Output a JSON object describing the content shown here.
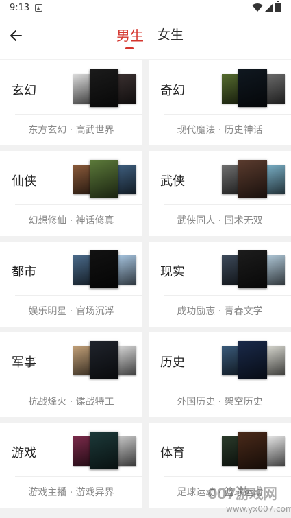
{
  "status_bar": {
    "time": "9:13"
  },
  "header": {
    "back_icon": "arrow-left-icon",
    "tabs": [
      {
        "label": "男生",
        "active": true
      },
      {
        "label": "女生",
        "active": false
      }
    ],
    "accent_color": "#d4352e"
  },
  "categories": [
    {
      "name": "玄幻",
      "tags": "东方玄幻 · 高武世界",
      "cover_colors": [
        "#dcdcdc",
        "#1b1b1b",
        "#3a3030"
      ]
    },
    {
      "name": "奇幻",
      "tags": "现代魔法 · 历史神话",
      "cover_colors": [
        "#556b2f",
        "#101820",
        "#6b6b6b"
      ]
    },
    {
      "name": "仙侠",
      "tags": "幻想修仙 · 神话修真",
      "cover_colors": [
        "#8a5a3a",
        "#5c7a3a",
        "#3f5f7f"
      ]
    },
    {
      "name": "武侠",
      "tags": "武侠同人 · 国术无双",
      "cover_colors": [
        "#6f6f6f",
        "#5a3b2e",
        "#7ab0c7"
      ]
    },
    {
      "name": "都市",
      "tags": "娱乐明星 · 官场沉浮",
      "cover_colors": [
        "#4a6a8a",
        "#121212",
        "#a7c5e0"
      ]
    },
    {
      "name": "现实",
      "tags": "成功励志 · 青春文学",
      "cover_colors": [
        "#3d4a5a",
        "#1c1c1c",
        "#b0c8d8"
      ]
    },
    {
      "name": "军事",
      "tags": "抗战烽火 · 谍战特工",
      "cover_colors": [
        "#c2a078",
        "#20242c",
        "#d8d8d8"
      ]
    },
    {
      "name": "历史",
      "tags": "外国历史 · 架空历史",
      "cover_colors": [
        "#3a5a7a",
        "#1a2a4a",
        "#d8d8d0"
      ]
    },
    {
      "name": "游戏",
      "tags": "游戏主播 · 游戏异界",
      "cover_colors": [
        "#7a2a4a",
        "#1d3a3a",
        "#c8c8c8"
      ]
    },
    {
      "name": "体育",
      "tags": "足球运动 · 篮球运动",
      "cover_colors": [
        "#2a3a2a",
        "#4a2a1a",
        "#e8e8e8"
      ]
    }
  ],
  "watermark": {
    "text": "007游戏网",
    "url": "www.yx007.com"
  }
}
